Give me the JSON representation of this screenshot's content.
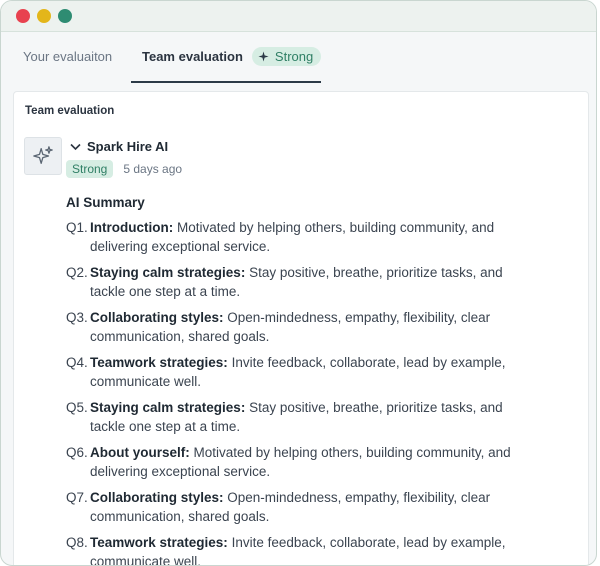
{
  "tabs": [
    {
      "label": "Your evaluaiton"
    },
    {
      "label": "Team evaluation",
      "badge": "Strong"
    }
  ],
  "card": {
    "title": "Team evaluation",
    "author": "Spark Hire AI",
    "status": "Strong",
    "time_ago": "5 days ago",
    "summary_title": "AI Summary",
    "items": [
      {
        "num": "Q1.",
        "label": "Introduction:",
        "text": " Motivated by helping others, building community, and delivering  exceptional service."
      },
      {
        "num": "Q2.",
        "label": "Staying calm strategies:",
        "text": " Stay positive, breathe, prioritize tasks, and tackle one step at a time."
      },
      {
        "num": "Q3.",
        "label": "Collaborating styles:",
        "text": " Open-mindedness, empathy, flexibility, clear communication, shared goals."
      },
      {
        "num": "Q4.",
        "label": "Teamwork strategies:",
        "text": " Invite feedback, collaborate, lead by example, communicate well."
      },
      {
        "num": "Q5.",
        "label": "Staying calm strategies:",
        "text": " Stay positive, breathe, prioritize tasks, and tackle one step at a time."
      },
      {
        "num": "Q6.",
        "label": "About yourself:",
        "text": " Motivated by helping others, building community, and delivering  exceptional service."
      },
      {
        "num": "Q7.",
        "label": "Collaborating styles:",
        "text": " Open-mindedness, empathy, flexibility, clear communication, shared goals."
      },
      {
        "num": "Q8.",
        "label": "Teamwork strategies:",
        "text": " Invite feedback, collaborate, lead by example, communicate well."
      }
    ]
  },
  "colors": {
    "accent_green": "#2f7f65",
    "badge_bg": "#d6ede3",
    "tab_underline": "#2c3a47",
    "window_red": "#e8424f",
    "window_yellow": "#e3b61a",
    "window_green": "#2e8c72"
  },
  "icons": {
    "avatar": "sparkles-icon",
    "tab_badge": "sparkles-icon",
    "author_toggle": "chevron-down-icon"
  }
}
